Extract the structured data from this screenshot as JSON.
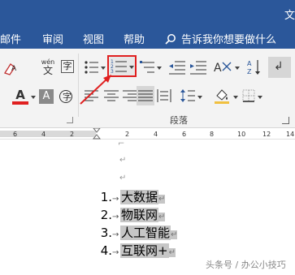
{
  "window": {
    "title_fragment": "文"
  },
  "menu": {
    "items": [
      "邮件",
      "审阅",
      "视图",
      "帮助"
    ],
    "tell_me": "告诉我你想要做什么"
  },
  "ribbon": {
    "font": {
      "wen_top": "wén",
      "wen_bottom": "文",
      "font_color_letter": "A",
      "char_shading_letter": "A",
      "char_border_letter": "字"
    },
    "paragraph": {
      "group_label": "段落"
    }
  },
  "ruler": {
    "ticks": [
      "6",
      "4",
      "2",
      "2",
      "4",
      "6",
      "8",
      "10",
      "12",
      "14",
      "16"
    ]
  },
  "document": {
    "list": [
      {
        "num": "1.",
        "text": "大数据"
      },
      {
        "num": "2.",
        "text": "物联网"
      },
      {
        "num": "3.",
        "text": "人工智能"
      },
      {
        "num": "4.",
        "text": "互联网+"
      }
    ]
  },
  "watermark": "头条号 / 办公小技巧",
  "colors": {
    "accent": "#2b579a",
    "highlight": "#c6c6c6",
    "annotation": "#e02020",
    "font_color_bar": "#e02020"
  }
}
